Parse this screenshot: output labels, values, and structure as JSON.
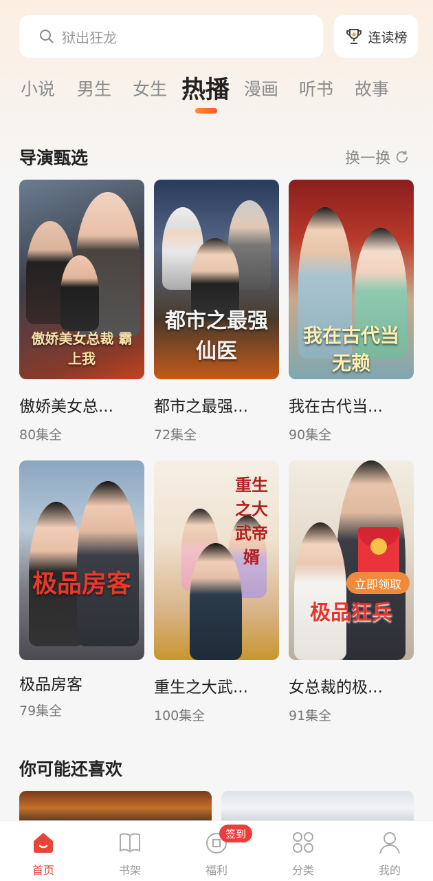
{
  "search": {
    "placeholder_text": "狱出狂龙"
  },
  "rank_button": {
    "label": "连读榜"
  },
  "tabs": [
    {
      "label": "小说",
      "active": false
    },
    {
      "label": "男生",
      "active": false
    },
    {
      "label": "女生",
      "active": false
    },
    {
      "label": "热播",
      "active": true
    },
    {
      "label": "漫画",
      "active": false
    },
    {
      "label": "听书",
      "active": false
    },
    {
      "label": "故事",
      "active": false
    }
  ],
  "director_picks": {
    "title": "导演甄选",
    "refresh_label": "换一换",
    "items": [
      {
        "title": "傲娇美女总...",
        "episodes": "80集全",
        "poster_text": "傲娇美女总裁 霸上我"
      },
      {
        "title": "都市之最强...",
        "episodes": "72集全",
        "poster_text": "都市之最强仙医"
      },
      {
        "title": "我在古代当...",
        "episodes": "90集全",
        "poster_text": "我在古代当无赖"
      },
      {
        "title": "极品房客",
        "episodes": "79集全",
        "poster_text": "极品房客"
      },
      {
        "title": "重生之大武...",
        "episodes": "100集全",
        "poster_text": "重生之大武帝婿"
      },
      {
        "title": "女总裁的极...",
        "episodes": "91集全",
        "poster_text": "极品狂兵"
      }
    ]
  },
  "promo": {
    "claim_label": "立即领取"
  },
  "recommend": {
    "title": "你可能还喜欢"
  },
  "nav": {
    "items": [
      {
        "label": "首页",
        "icon": "home-icon",
        "active": true
      },
      {
        "label": "书架",
        "icon": "bookshelf-icon",
        "active": false
      },
      {
        "label": "福利",
        "icon": "welfare-icon",
        "active": false
      },
      {
        "label": "分类",
        "icon": "category-icon",
        "active": false
      },
      {
        "label": "我的",
        "icon": "profile-icon",
        "active": false
      }
    ],
    "sign_badge": "签到"
  },
  "colors": {
    "accent": "#e8443a",
    "tab_underline": "#ff6a2a",
    "claim_badge": "#f08a3a",
    "red_packet": "#e8343a"
  }
}
